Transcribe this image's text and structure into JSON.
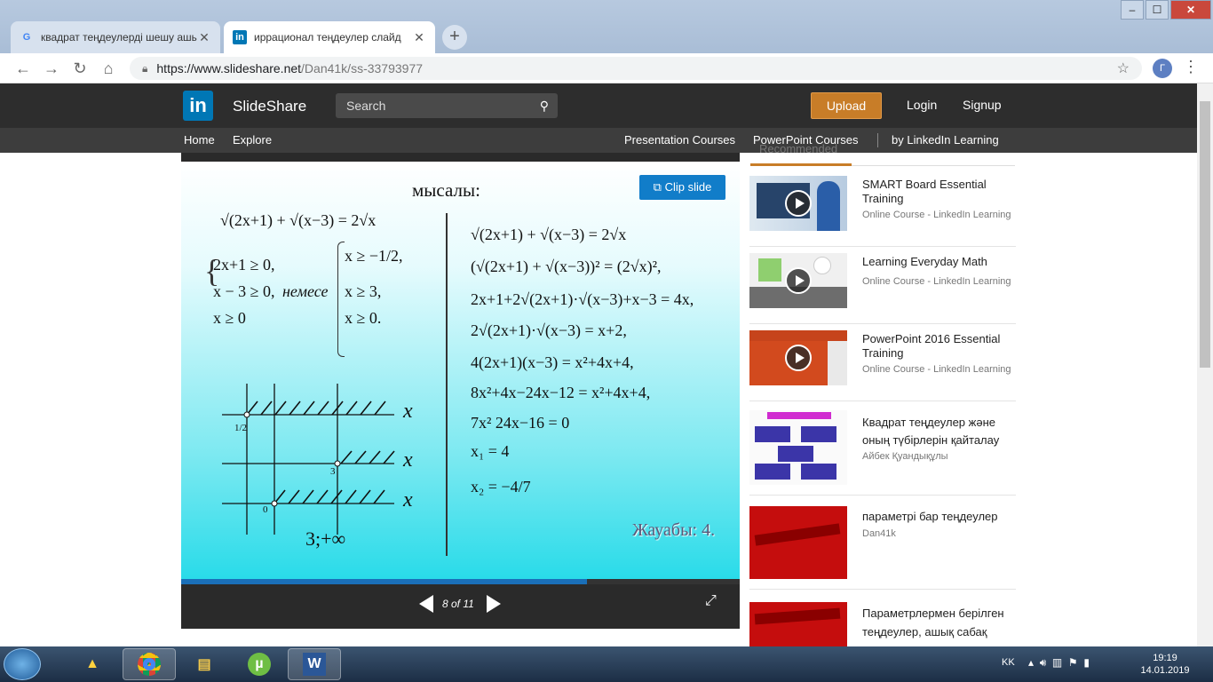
{
  "browser": {
    "tabs": [
      {
        "label": "квадрат теңдеулерді шешу ашық",
        "icon": "google-icon",
        "active": false
      },
      {
        "label": "иррационал теңдеулер слайд",
        "icon": "linkedin-icon",
        "active": true
      }
    ],
    "url_domain": "https://www.slideshare.net",
    "url_path": "/Dan41k/ss-33793977",
    "profile_initial": "Г"
  },
  "slideshare": {
    "logo_text": "SlideShare",
    "logo_letters": "in",
    "search_placeholder": "Search",
    "upload_label": "Upload",
    "login_label": "Login",
    "signup_label": "Signup",
    "nav_left": [
      "Home",
      "Explore"
    ],
    "nav_right": [
      "Presentation Courses",
      "PowerPoint Courses",
      "by LinkedIn Learning"
    ]
  },
  "player": {
    "clip_label": "Clip slide",
    "page_indicator": "8 of 11",
    "progress": 0.727,
    "slide": {
      "title": "мысалы:",
      "left_eq": "√(2x+1) + √(x−3) = 2√x",
      "system_a": [
        "2x+1 ≥ 0,",
        "x − 3 ≥ 0,",
        "x ≥ 0"
      ],
      "connector": "немесе",
      "system_b": [
        "x ≥ −1/2,",
        "x ≥ 3,",
        "x ≥ 0."
      ],
      "axis_label": "x",
      "tick_half": "1/2",
      "tick_three": "3",
      "tick_zero": "0",
      "interval": "3;+∞",
      "right_steps": [
        "√(2x+1) + √(x−3) = 2√x",
        "(√(2x+1) + √(x−3))² = (2√x)²,",
        "2x+1+2√(2x+1)·√(x−3)+x−3 = 4x,",
        "2√(2x+1)·√(x−3) = x+2,",
        "4(2x+1)(x−3) = x²+4x+4,",
        "8x²+4x−24x−12 = x²+4x+4,",
        "7x² 24x−16 = 0",
        "x₁ = 4",
        "x₂ = −4/7"
      ],
      "answer": "Жауабы: 4."
    }
  },
  "sidebar": {
    "heading": "Recommended",
    "items": [
      {
        "title": "SMART Board Essential Training",
        "source": "Online Course - LinkedIn Learning",
        "video": true
      },
      {
        "title": "Learning Everyday Math",
        "source": "Online Course - LinkedIn Learning",
        "video": true
      },
      {
        "title": "PowerPoint 2016 Essential Training",
        "source": "Online Course - LinkedIn Learning",
        "video": true
      },
      {
        "title": "Квадрат теңдеулер және оның түбірлерін қайталау",
        "source": "Айбек Қуандықұлы",
        "video": false
      },
      {
        "title": "параметрі бар теңдеулер",
        "source": "Dan41k",
        "video": false
      },
      {
        "title": "Параметрлермен берілген теңдеулер, ашық сабақ",
        "source": "",
        "video": false
      }
    ]
  },
  "taskbar": {
    "lang": "KK",
    "time": "19:19",
    "date": "14.01.2019"
  },
  "colors": {
    "accent": "#c87d28",
    "linkedin": "#0077b5",
    "clip": "#117dc9"
  }
}
